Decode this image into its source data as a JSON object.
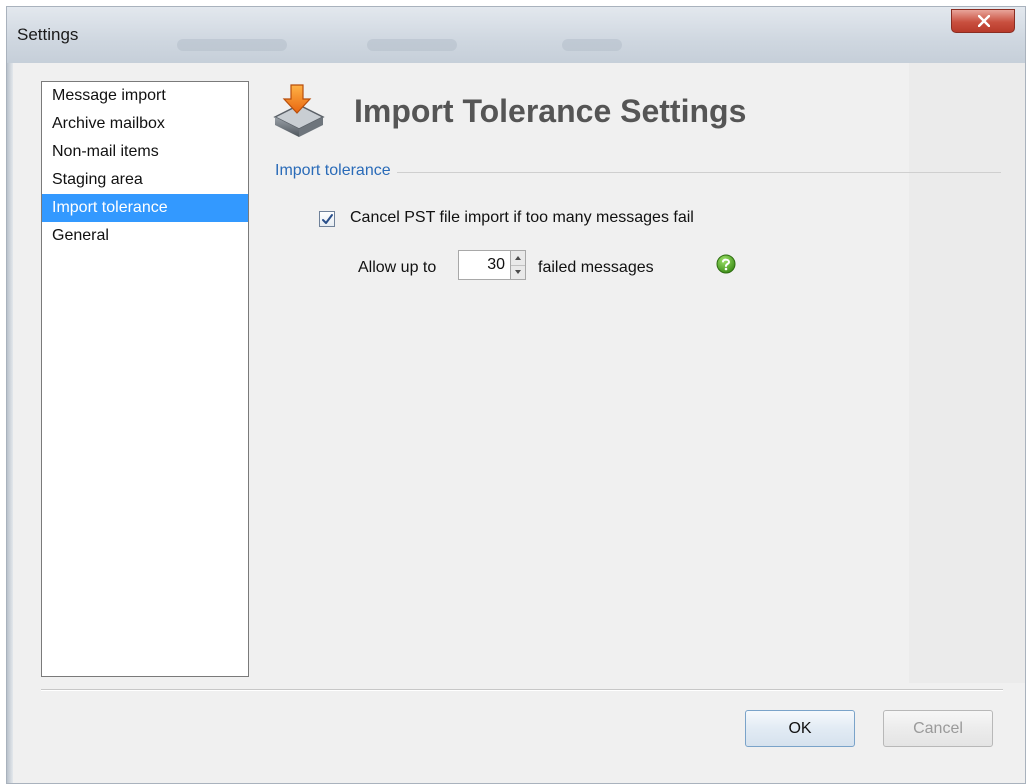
{
  "window": {
    "title": "Settings",
    "close_label": "×"
  },
  "sidebar": {
    "items": [
      {
        "label": "Message import",
        "selected": false
      },
      {
        "label": "Archive mailbox",
        "selected": false
      },
      {
        "label": "Non-mail items",
        "selected": false
      },
      {
        "label": "Staging area",
        "selected": false
      },
      {
        "label": "Import tolerance",
        "selected": true
      },
      {
        "label": "General",
        "selected": false
      }
    ]
  },
  "main": {
    "title": "Import Tolerance Settings",
    "title_icon": "import-tray-icon",
    "group_label": "Import tolerance",
    "cancel_checkbox": {
      "label": "Cancel PST file import if too many messages fail",
      "checked": true
    },
    "allow_prefix": "Allow up to",
    "failed_count": "30",
    "allow_suffix": "failed messages",
    "help_icon": "help-icon"
  },
  "footer": {
    "ok_label": "OK",
    "cancel_label": "Cancel"
  },
  "colors": {
    "selection": "#3399ff",
    "group_label": "#2a6bb8",
    "help_green": "#5aa52e",
    "close_red": "#c9503f"
  }
}
